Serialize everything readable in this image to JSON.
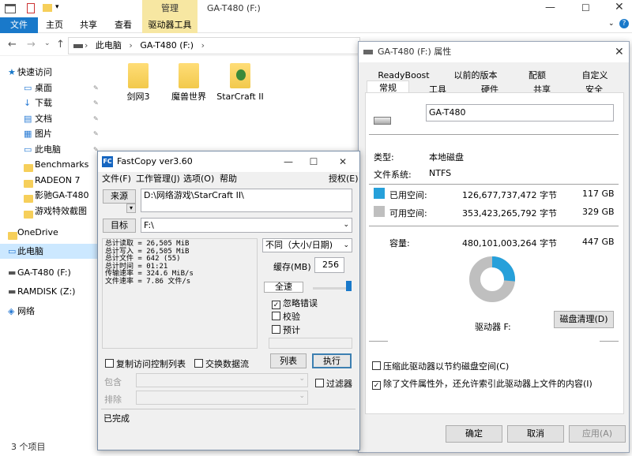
{
  "explorer": {
    "title": "GA-T480 (F:)",
    "context_tab": "管理",
    "ribbon_tabs": [
      "文件",
      "主页",
      "共享",
      "查看",
      "驱动器工具"
    ],
    "breadcrumb": [
      "此电脑",
      "GA-T480 (F:)"
    ],
    "sidebar": [
      {
        "label": "快速访问",
        "icon": "star-icon",
        "pinned": false
      },
      {
        "label": "桌面",
        "icon": "desktop-icon",
        "pinned": true
      },
      {
        "label": "下载",
        "icon": "download-icon",
        "pinned": true
      },
      {
        "label": "文档",
        "icon": "document-icon",
        "pinned": true
      },
      {
        "label": "图片",
        "icon": "picture-icon",
        "pinned": true
      },
      {
        "label": "此电脑",
        "icon": "computer-icon",
        "pinned": true
      },
      {
        "label": "Benchmarks",
        "icon": "folder-icon",
        "pinned": false
      },
      {
        "label": "RADEON 7",
        "icon": "folder-icon",
        "pinned": false
      },
      {
        "label": "影驰GA-T480",
        "icon": "folder-icon",
        "pinned": false
      },
      {
        "label": "游戏特效截图",
        "icon": "folder-icon",
        "pinned": false
      },
      {
        "label": "OneDrive",
        "icon": "folder-icon",
        "pinned": false
      },
      {
        "label": "此电脑",
        "icon": "computer-icon",
        "pinned": false
      },
      {
        "label": "GA-T480 (F:)",
        "icon": "drive-icon",
        "pinned": false
      },
      {
        "label": "RAMDISK (Z:)",
        "icon": "drive-icon",
        "pinned": false
      },
      {
        "label": "网络",
        "icon": "network-icon",
        "pinned": false
      }
    ],
    "files": [
      {
        "label": "剑网3"
      },
      {
        "label": "魔兽世界"
      },
      {
        "label": "StarCraft II"
      }
    ],
    "status": "3 个项目"
  },
  "fastcopy": {
    "title": "FastCopy ver3.60",
    "menu": [
      "文件(F)",
      "工作管理(J)",
      "选项(O)",
      "帮助",
      "授权(E)"
    ],
    "source_label": "来源",
    "source_value": "D:\\网络游戏\\StarCraft II\\",
    "dest_label": "目标",
    "dest_value": "F:\\",
    "log": "总计读取 = 26,505 MiB\n总计写入 = 26,505 MiB\n总计文件 = 642 (55)\n总计时间 = 01:21\n传输速率 = 324.6 MiB/s\n文件速率 = 7.86 文件/s",
    "mode": "不同（大小/日期)",
    "buffer_label": "缓存(MB)",
    "buffer_value": "256",
    "speed_label": "全速",
    "opt_ignore": "忽略错误",
    "opt_verify": "校验",
    "opt_estimate": "预计",
    "copy_acl": "复制访问控制列表",
    "alt_stream": "交换数据流",
    "list_button": "列表",
    "execute_button": "执行",
    "include_label": "包含",
    "exclude_label": "排除",
    "filter_label": "过滤器",
    "status": "已完成"
  },
  "props": {
    "title": "GA-T480 (F:) 属性",
    "tabs_row1": [
      "ReadyBoost",
      "以前的版本",
      "配额",
      "自定义"
    ],
    "tabs_row2": [
      "常规",
      "工具",
      "硬件",
      "共享",
      "安全"
    ],
    "drive_name": "GA-T480",
    "type_label": "类型:",
    "type_value": "本地磁盘",
    "fs_label": "文件系统:",
    "fs_value": "NTFS",
    "used_label": "已用空间:",
    "used_bytes": "126,677,737,472 字节",
    "used_gb": "117 GB",
    "free_label": "可用空间:",
    "free_bytes": "353,423,265,792 字节",
    "free_gb": "329 GB",
    "cap_label": "容量:",
    "cap_bytes": "480,101,003,264 字节",
    "cap_gb": "447 GB",
    "drive_label": "驱动器 F:",
    "cleanup": "磁盘清理(D)",
    "compress": "压缩此驱动器以节约磁盘空间(C)",
    "index": "除了文件属性外，还允许索引此驱动器上文件的内容(I)",
    "ok": "确定",
    "cancel": "取消",
    "apply": "应用(A)",
    "used_color": "#26a0da",
    "free_color": "#bfbfbf",
    "used_fraction": 0.264
  }
}
